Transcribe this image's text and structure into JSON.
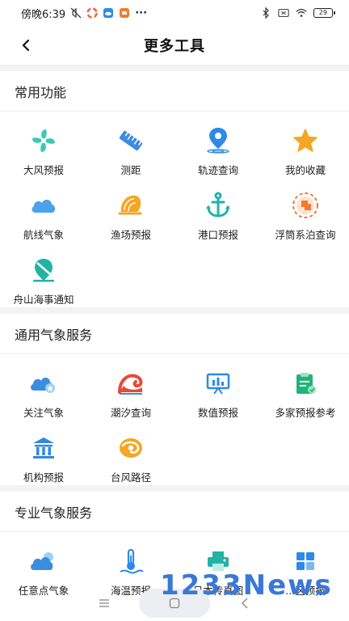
{
  "status_bar": {
    "time": "傍晚6:39",
    "battery": "29"
  },
  "nav": {
    "title": "更多工具"
  },
  "sections": [
    {
      "title": "常用功能",
      "items": [
        {
          "label": "大风预报",
          "icon": "wind-icon",
          "color": "#3cc8b4"
        },
        {
          "label": "测距",
          "icon": "ruler-icon",
          "color": "#3b8de0"
        },
        {
          "label": "轨迹查询",
          "icon": "location-pin-icon",
          "color": "#2d8ae6"
        },
        {
          "label": "我的收藏",
          "icon": "star-icon",
          "color": "#f5a623"
        },
        {
          "label": "航线气象",
          "icon": "cloud-icon",
          "color": "#4aa3e8"
        },
        {
          "label": "渔场预报",
          "icon": "shell-icon",
          "color": "#f5a623"
        },
        {
          "label": "港口预报",
          "icon": "anchor-icon",
          "color": "#22b3a6"
        },
        {
          "label": "浮筒系泊查询",
          "icon": "buoy-icon",
          "color": "#f07b2e"
        },
        {
          "label": "舟山海事通知",
          "icon": "notice-icon",
          "color": "#22b3a6"
        }
      ]
    },
    {
      "title": "通用气象服务",
      "items": [
        {
          "label": "关注气象",
          "icon": "cloud-star-icon",
          "color": "#3b8de0"
        },
        {
          "label": "潮汐查询",
          "icon": "wave-icon",
          "color": "#e8483a"
        },
        {
          "label": "数值预报",
          "icon": "chart-board-icon",
          "color": "#2d8ae6"
        },
        {
          "label": "多家预报参考",
          "icon": "clipboard-icon",
          "color": "#22b37a"
        },
        {
          "label": "机构预报",
          "icon": "building-icon",
          "color": "#2d8ae6"
        },
        {
          "label": "台风路径",
          "icon": "typhoon-icon",
          "color": "#f5a623"
        }
      ]
    },
    {
      "title": "专业气象服务",
      "items": [
        {
          "label": "任意点气象",
          "icon": "cloud-sun-icon",
          "color": "#3b8de0"
        },
        {
          "label": "海温预报",
          "icon": "thermometer-icon",
          "color": "#2d8ae6"
        },
        {
          "label": "日本传真图",
          "icon": "fax-icon",
          "color": "#22b3a6"
        },
        {
          "label": "...区预报",
          "icon": "grid-icon",
          "color": "#2d8ae6"
        }
      ]
    }
  ],
  "watermark": "1233News"
}
